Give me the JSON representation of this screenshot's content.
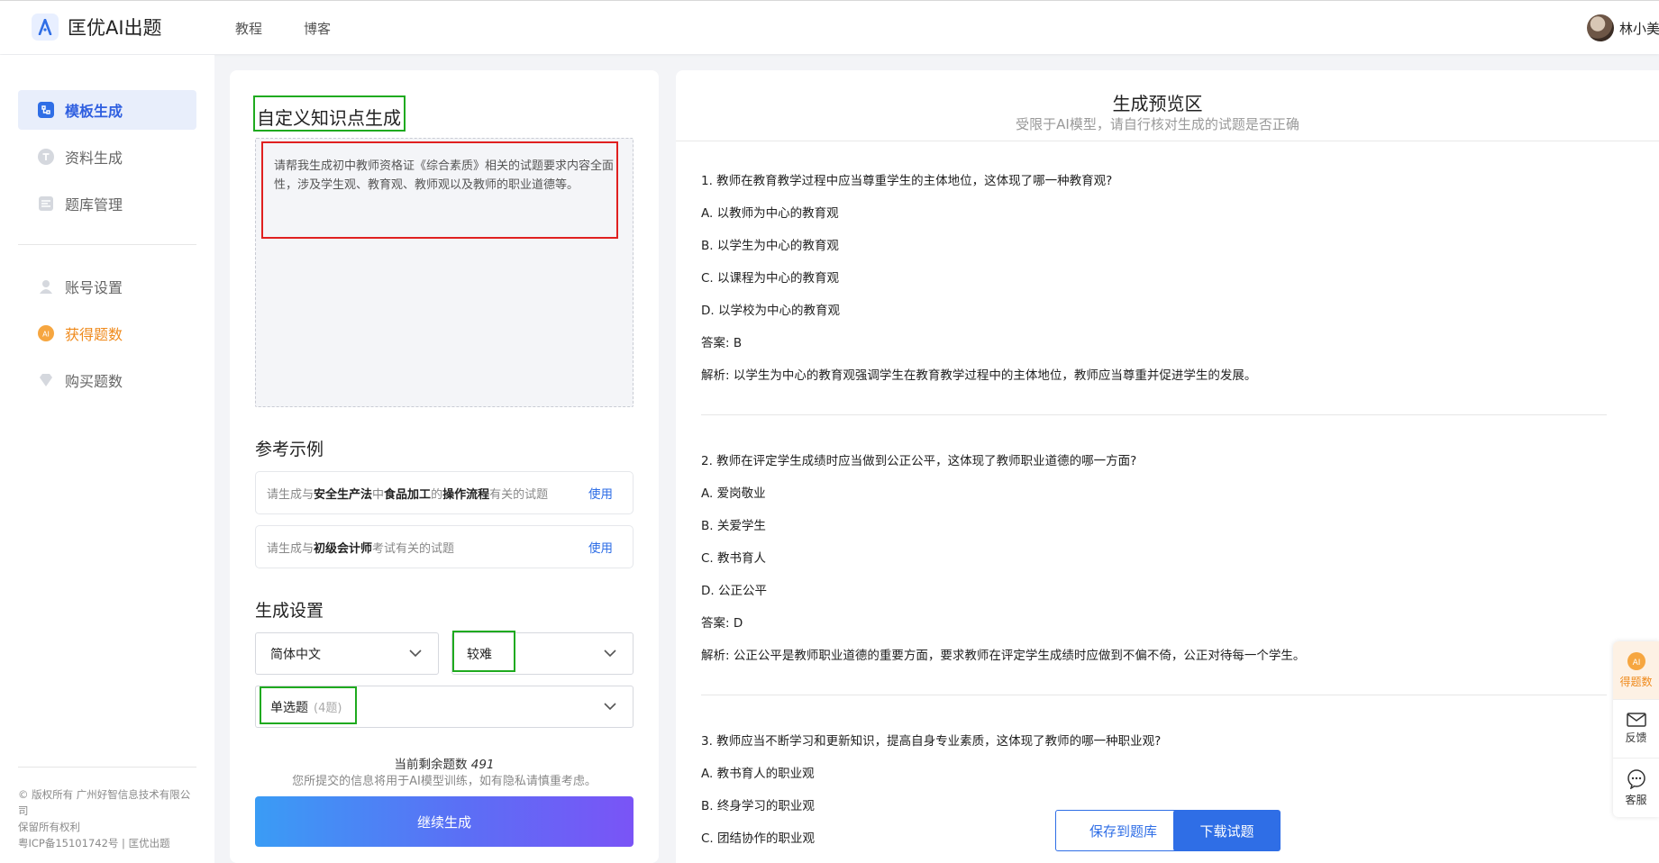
{
  "header": {
    "app_name": "匡优AI出题",
    "nav": [
      "教程",
      "博客"
    ],
    "user_name": "林小美"
  },
  "sidebar": {
    "items": [
      {
        "label": "模板生成",
        "icon": "template-icon"
      },
      {
        "label": "资料生成",
        "icon": "document-t-icon"
      },
      {
        "label": "题库管理",
        "icon": "question-bank-icon"
      },
      {
        "label": "账号设置",
        "icon": "user-icon"
      },
      {
        "label": "获得题数",
        "icon": "ai-coin-icon"
      },
      {
        "label": "购买题数",
        "icon": "diamond-icon"
      }
    ],
    "footer": [
      "© 版权所有 广州好智信息技术有限公司",
      "保留所有权利",
      "粤ICP备15101742号 | 匡优出题"
    ]
  },
  "form": {
    "title": "自定义知识点生成",
    "prompt": "请帮我生成初中教师资格证《综合素质》相关的试题要求内容全面性，涉及学生观、教育观、教师观以及教师的职业道德等。",
    "examples_title": "参考示例",
    "example1": {
      "p1": "请生成与",
      "b1": "安全生产法",
      "p2": "中",
      "b2": "食品加工",
      "p3": "的",
      "b3": "操作流程",
      "p4": "有关的试题"
    },
    "example2": {
      "p1": "请生成与",
      "b1": "初级会计师",
      "p2": "考试有关的试题"
    },
    "use_label": "使用",
    "settings_title": "生成设置",
    "language": "简体中文",
    "difficulty": "较难",
    "question_type": "单选题",
    "question_count": "(4题)",
    "remaining_label": "当前剩余题数",
    "remaining_value": "491",
    "privacy_note": "您所提交的信息将用于AI模型训练，如有隐私请慎重考虑。",
    "generate_button": "继续生成"
  },
  "preview": {
    "title": "生成预览区",
    "subtitle": "受限于AI模型，请自行核对生成的试题是否正确",
    "questions": [
      {
        "stem": "1. 教师在教育教学过程中应当尊重学生的主体地位，这体现了哪一种教育观?",
        "options": [
          "A. 以教师为中心的教育观",
          "B. 以学生为中心的教育观",
          "C. 以课程为中心的教育观",
          "D. 以学校为中心的教育观"
        ],
        "answer": "答案: B",
        "analysis": "解析: 以学生为中心的教育观强调学生在教育教学过程中的主体地位，教师应当尊重并促进学生的发展。"
      },
      {
        "stem": "2. 教师在评定学生成绩时应当做到公正公平，这体现了教师职业道德的哪一方面?",
        "options": [
          "A. 爱岗敬业",
          "B. 关爱学生",
          "C. 教书育人",
          "D. 公正公平"
        ],
        "answer": "答案: D",
        "analysis": "解析: 公正公平是教师职业道德的重要方面，要求教师在评定学生成绩时应做到不偏不倚，公正对待每一个学生。"
      },
      {
        "stem": "3. 教师应当不断学习和更新知识，提高自身专业素质，这体现了教师的哪一种职业观?",
        "options": [
          "A. 教书育人的职业观",
          "B. 终身学习的职业观",
          "C. 团结协作的职业观"
        ]
      }
    ],
    "save_button": "保存到题库",
    "download_button": "下载试题"
  },
  "float_bar": [
    {
      "label": "得题数",
      "icon": "ai-coin-icon"
    },
    {
      "label": "反馈",
      "icon": "mail-icon"
    },
    {
      "label": "客服",
      "icon": "chat-icon"
    }
  ],
  "colors": {
    "primary": "#2f6ee6",
    "accent_orange": "#ef8a1c",
    "highlight_green": "#1faa1f",
    "highlight_red": "#e02020"
  }
}
